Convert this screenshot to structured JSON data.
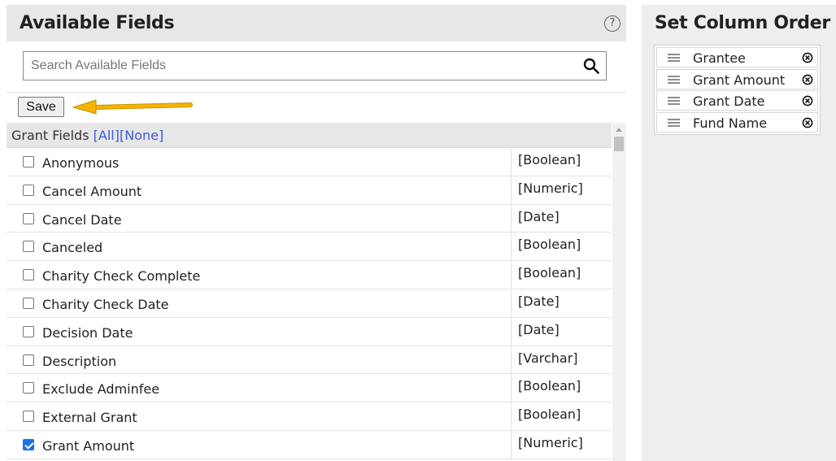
{
  "available_fields": {
    "title": "Available Fields",
    "help_symbol": "?",
    "search": {
      "placeholder": "Search Available Fields",
      "value": ""
    },
    "save_label": "Save",
    "group": {
      "label": "Grant Fields",
      "all_link": "[All]",
      "none_link": "[None]"
    },
    "fields": [
      {
        "name": "Anonymous",
        "type": "[Boolean]",
        "checked": false
      },
      {
        "name": "Cancel Amount",
        "type": "[Numeric]",
        "checked": false
      },
      {
        "name": "Cancel Date",
        "type": "[Date]",
        "checked": false
      },
      {
        "name": "Canceled",
        "type": "[Boolean]",
        "checked": false
      },
      {
        "name": "Charity Check Complete",
        "type": "[Boolean]",
        "checked": false
      },
      {
        "name": "Charity Check Date",
        "type": "[Date]",
        "checked": false
      },
      {
        "name": "Decision Date",
        "type": "[Date]",
        "checked": false
      },
      {
        "name": "Description",
        "type": "[Varchar]",
        "checked": false
      },
      {
        "name": "Exclude Adminfee",
        "type": "[Boolean]",
        "checked": false
      },
      {
        "name": "External Grant",
        "type": "[Boolean]",
        "checked": false
      },
      {
        "name": "Grant Amount",
        "type": "[Numeric]",
        "checked": true
      }
    ]
  },
  "column_order": {
    "title": "Set Column Order",
    "items": [
      {
        "label": "Grantee"
      },
      {
        "label": "Grant Amount"
      },
      {
        "label": "Grant Date"
      },
      {
        "label": "Fund Name"
      }
    ]
  },
  "colors": {
    "header_bg": "#e7e7e7",
    "link": "#3b5bdb",
    "arrow": "#f5b400",
    "checkbox_checked": "#1a73e8"
  }
}
